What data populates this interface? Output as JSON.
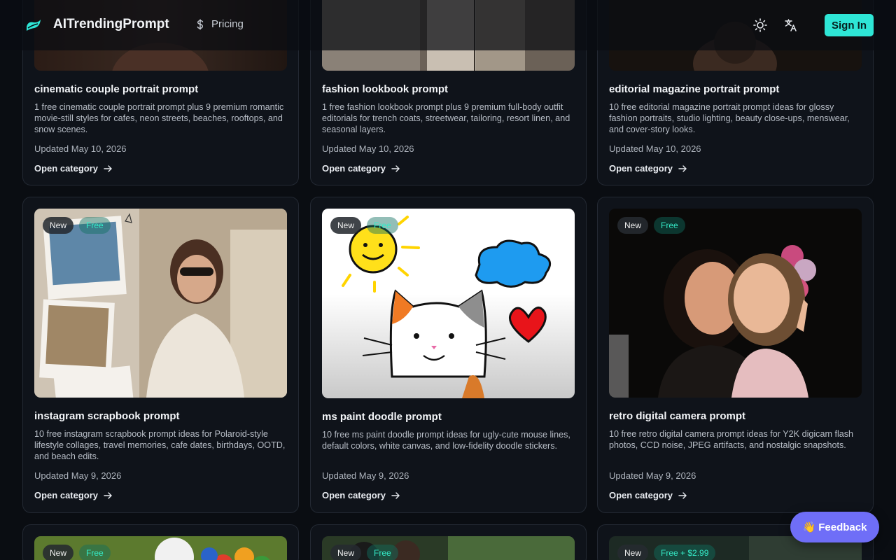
{
  "header": {
    "brand": "AITrendingPrompt",
    "pricing_label": "Pricing",
    "signin_label": "Sign In",
    "theme_icon": "sun-icon",
    "language_icon": "translate-icon",
    "accent": "#2ee6d6"
  },
  "row1": [
    {
      "title": "cinematic couple portrait prompt",
      "desc": "1 free cinematic couple portrait prompt plus 9 premium romantic movie-still styles for cafes, neon streets, beaches, rooftops, and snow scenes.",
      "date": "Updated May 10, 2026",
      "link": "Open category"
    },
    {
      "title": "fashion lookbook prompt",
      "desc": "1 free fashion lookbook prompt plus 9 premium full-body outfit editorials for trench coats, streetwear, tailoring, resort linen, and seasonal layers.",
      "date": "Updated May 10, 2026",
      "link": "Open category"
    },
    {
      "title": "editorial magazine portrait prompt",
      "desc": "10 free editorial magazine portrait prompt ideas for glossy fashion portraits, studio lighting, beauty close-ups, menswear, and cover-story looks.",
      "date": "Updated May 10, 2026",
      "link": "Open category"
    }
  ],
  "row2": [
    {
      "badge_new": "New",
      "badge_free": "Free",
      "title": "instagram scrapbook prompt",
      "desc": "10 free instagram scrapbook prompt ideas for Polaroid-style lifestyle collages, travel memories, cafe dates, birthdays, OOTD, and beach edits.",
      "date": "Updated May 9, 2026",
      "link": "Open category"
    },
    {
      "badge_new": "New",
      "badge_free": "Free",
      "title": "ms paint doodle prompt",
      "desc": "10 free ms paint doodle prompt ideas for ugly-cute mouse lines, default colors, white canvas, and low-fidelity doodle stickers.",
      "date": "Updated May 9, 2026",
      "link": "Open category"
    },
    {
      "badge_new": "New",
      "badge_free": "Free",
      "title": "retro digital camera prompt",
      "desc": "10 free retro digital camera prompt ideas for Y2K digicam flash photos, CCD noise, JPEG artifacts, and nostalgic snapshots.",
      "date": "Updated May 9, 2026",
      "link": "Open category"
    }
  ],
  "row3": [
    {
      "badge_new": "New",
      "badge_free": "Free"
    },
    {
      "badge_new": "New",
      "badge_free": "Free"
    },
    {
      "badge_new": "New",
      "badge_free": "Free + $2.99"
    }
  ],
  "feedback": {
    "emoji": "👋",
    "label": "Feedback"
  }
}
